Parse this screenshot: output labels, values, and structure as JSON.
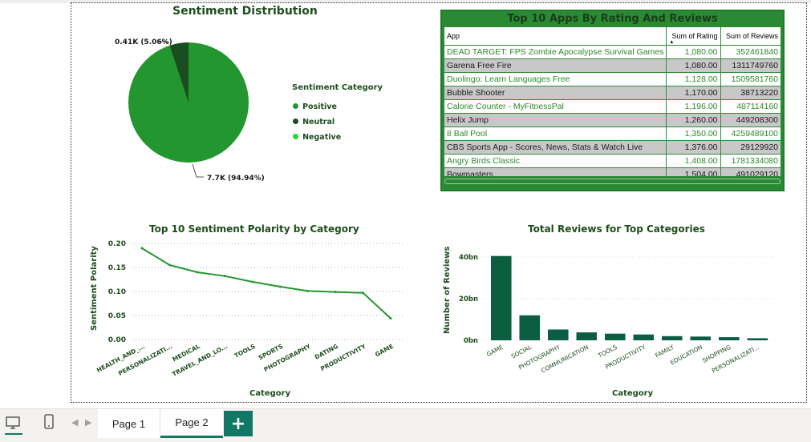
{
  "pie": {
    "title": "Sentiment Distribution",
    "legend_title": "Sentiment Category",
    "legend": [
      {
        "label": "Positive",
        "color": "#23962f"
      },
      {
        "label": "Neutral",
        "color": "#1a4d1f"
      },
      {
        "label": "Negative",
        "color": "#2fd13a"
      }
    ],
    "label_neutral": "0.41K (5.06%)",
    "label_positive": "7.7K (94.94%)"
  },
  "table": {
    "title": "Top 10 Apps By Rating And Reviews",
    "headers": [
      "App",
      "Sum of Rating",
      "Sum of Reviews"
    ],
    "rows": [
      [
        "DEAD TARGET: FPS Zombie Apocalypse Survival Games",
        "1,080.00",
        "352461840"
      ],
      [
        "Garena Free Fire",
        "1,080.00",
        "1311749760"
      ],
      [
        "Duolingo: Learn Languages Free",
        "1,128.00",
        "1509581760"
      ],
      [
        "Bubble Shooter",
        "1,170.00",
        "38713220"
      ],
      [
        "Calorie Counter - MyFitnessPal",
        "1,196.00",
        "487114160"
      ],
      [
        "Helix Jump",
        "1,260.00",
        "449208300"
      ],
      [
        "8 Ball Pool",
        "1,350.00",
        "4259489100"
      ],
      [
        "CBS Sports App - Scores, News, Stats & Watch Live",
        "1,376.00",
        "29129920"
      ],
      [
        "Angry Birds Classic",
        "1,408.00",
        "1781334080"
      ],
      [
        "Bowmasters",
        "1,504.00",
        "491029120"
      ]
    ]
  },
  "chart_data": [
    {
      "type": "pie",
      "title": "Sentiment Distribution",
      "categories": [
        "Positive",
        "Neutral",
        "Negative"
      ],
      "values": [
        7700,
        410,
        0
      ],
      "percent": [
        94.94,
        5.06,
        0
      ]
    },
    {
      "type": "line",
      "title": "Top 10 Sentiment Polarity by Category",
      "xlabel": "Category",
      "ylabel": "Sentiment Polarity",
      "categories": [
        "HEALTH_AND_...",
        "PERSONALIZATI...",
        "MEDICAL",
        "TRAVEL_AND_LO...",
        "TOOLS",
        "SPORTS",
        "PHOTOGRAPHY",
        "DATING",
        "PRODUCTIVITY",
        "GAME"
      ],
      "values": [
        0.19,
        0.155,
        0.14,
        0.132,
        0.12,
        0.11,
        0.101,
        0.099,
        0.097,
        0.044
      ],
      "ylim": [
        0,
        0.2
      ],
      "yticks": [
        "0.00",
        "0.05",
        "0.10",
        "0.15",
        "0.20"
      ],
      "color": "#23962f"
    },
    {
      "type": "bar",
      "title": "Total Reviews for Top Categories",
      "xlabel": "Category",
      "ylabel": "Number of Reviews",
      "categories": [
        "GAME",
        "SOCIAL",
        "PHOTOGRAPHY",
        "COMMUNICATION",
        "TOOLS",
        "PRODUCTIVITY",
        "FAMILY",
        "EDUCATION",
        "SHOPPING",
        "PERSONALIZATI..."
      ],
      "values": [
        40.5,
        12.0,
        5.2,
        3.8,
        3.2,
        2.8,
        2.0,
        1.8,
        1.5,
        1.0
      ],
      "unit": "bn",
      "ylim": [
        0,
        45
      ],
      "yticks": [
        "0bn",
        "20bn",
        "40bn"
      ],
      "color": "#0b5e3f"
    }
  ],
  "pages": {
    "tabs": [
      "Page 1",
      "Page 2"
    ],
    "active": "Page 2",
    "add": "+"
  }
}
